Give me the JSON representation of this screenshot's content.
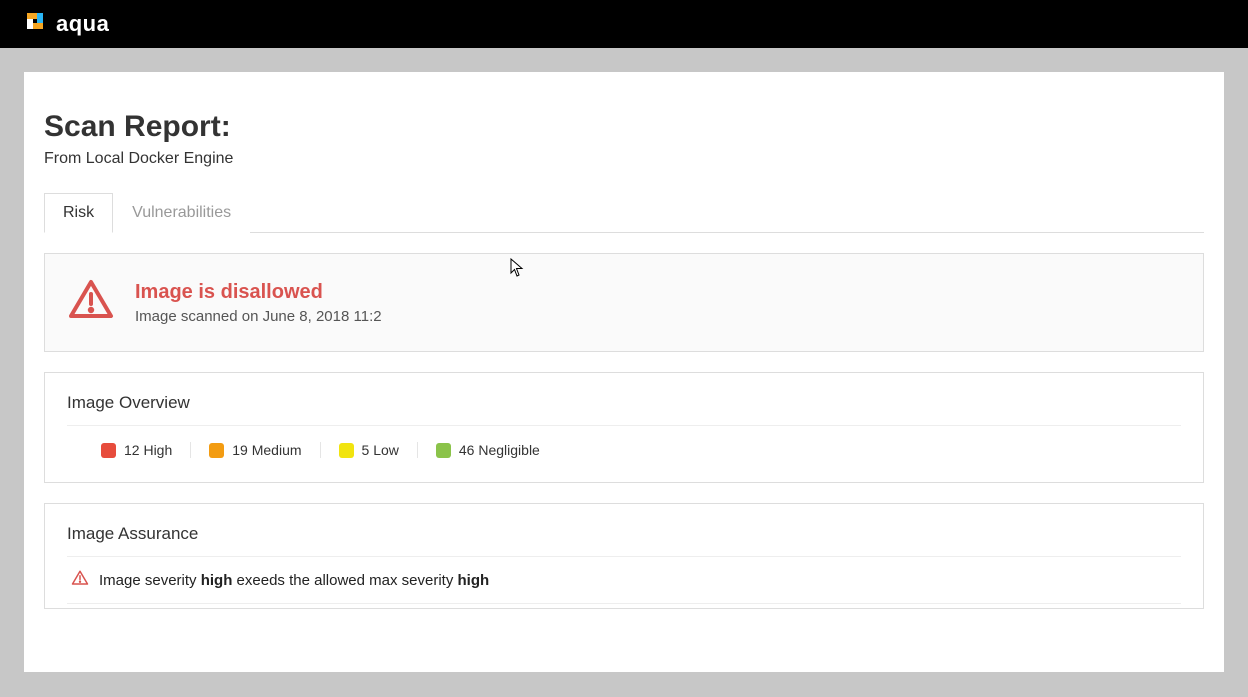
{
  "brand": {
    "name": "aqua"
  },
  "report": {
    "title": "Scan Report:",
    "subtitle": "From Local Docker Engine"
  },
  "tabs": {
    "risk": "Risk",
    "vulnerabilities": "Vulnerabilities"
  },
  "status": {
    "title": "Image is disallowed",
    "scanned_prefix": "Image scanned on ",
    "scanned_date": "June 8, 2018 11:2",
    "color": "#d9534f"
  },
  "overview": {
    "title": "Image Overview",
    "severities": [
      {
        "label": "12 High",
        "color": "#e74c3c"
      },
      {
        "label": "19 Medium",
        "color": "#f39c12"
      },
      {
        "label": "5 Low",
        "color": "#f1e40f"
      },
      {
        "label": "46 Negligible",
        "color": "#8bc34a"
      }
    ]
  },
  "assurance": {
    "title": "Image Assurance",
    "msg_prefix": "Image severity ",
    "msg_sev1": "high",
    "msg_mid": " exeeds the allowed max severity ",
    "msg_sev2": "high"
  },
  "chart_data": {
    "type": "bar",
    "title": "Image Overview",
    "categories": [
      "High",
      "Medium",
      "Low",
      "Negligible"
    ],
    "values": [
      12,
      19,
      5,
      46
    ],
    "colors": [
      "#e74c3c",
      "#f39c12",
      "#f1e40f",
      "#8bc34a"
    ],
    "xlabel": "",
    "ylabel": ""
  }
}
